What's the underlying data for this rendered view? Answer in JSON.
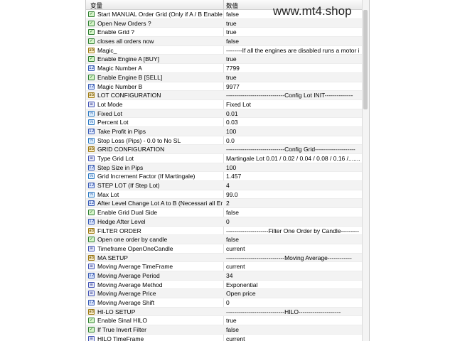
{
  "header": {
    "col_name": "变量",
    "col_value": "数值"
  },
  "watermark": "www.mt4.shop",
  "rows": [
    {
      "icon": "bool",
      "name": "Start MANUAL Order  Grid  (Only if A / B Enable)",
      "value": "false"
    },
    {
      "icon": "bool",
      "name": "Open New Orders ?",
      "value": "true"
    },
    {
      "icon": "bool",
      "name": "Enable Grid ?",
      "value": "true"
    },
    {
      "icon": "bool",
      "name": "closes all orders now",
      "value": "false"
    },
    {
      "icon": "str",
      "name": "Magic_",
      "value": "--------If all the engines are disabled runs a motor i..."
    },
    {
      "icon": "bool",
      "name": "Enable Engine A   [BUY]",
      "value": "true"
    },
    {
      "icon": "num",
      "name": "Magic Number  A",
      "value": "7799"
    },
    {
      "icon": "bool",
      "name": "Enable Engine B   [SELL]",
      "value": "true"
    },
    {
      "icon": "num",
      "name": "Magic Number  B",
      "value": "9977"
    },
    {
      "icon": "str",
      "name": "LOT CONFIGURATION",
      "value": "-----------------------------Config Lot INIT--------------"
    },
    {
      "icon": "enm",
      "name": "Lot Mode",
      "value": "Fixed Lot"
    },
    {
      "icon": "dbl",
      "name": "Fixed Lot",
      "value": "0.01"
    },
    {
      "icon": "dbl",
      "name": "Percent Lot",
      "value": "0.03"
    },
    {
      "icon": "num",
      "name": "Take Profit in Pips",
      "value": "100"
    },
    {
      "icon": "dbl",
      "name": "Stop Loss (Pips) - 0.0 to No SL",
      "value": "0.0"
    },
    {
      "icon": "str",
      "name": "GRID CONFIGURATION",
      "value": "-----------------------------Config Grid--------------------"
    },
    {
      "icon": "enm",
      "name": "Type Grid Lot",
      "value": "Martingale Lot  0.01 / 0.02 / 0.04 / 0.08 / 0.16 /........"
    },
    {
      "icon": "num",
      "name": "Step Size in Pips",
      "value": "100"
    },
    {
      "icon": "dbl",
      "name": "Grid Increment Factor (If Martingale)",
      "value": "1.457"
    },
    {
      "icon": "num",
      "name": "STEP LOT (If  Step Lot)",
      "value": "4"
    },
    {
      "icon": "dbl",
      "name": "Max Lot",
      "value": "99.0"
    },
    {
      "icon": "num",
      "name": "After Level Change Lot A to B (Necessari all Engi...",
      "value": "2"
    },
    {
      "icon": "bool",
      "name": "Enable Grid Dual Side",
      "value": "false"
    },
    {
      "icon": "num",
      "name": "Hedge After Level",
      "value": "0"
    },
    {
      "icon": "str",
      "name": "FILTER ORDER",
      "value": "---------------------Filter One Order by Candle---------"
    },
    {
      "icon": "bool",
      "name": "Open one order by candle",
      "value": "false"
    },
    {
      "icon": "enm",
      "name": "Timeframe OpenOneCandle",
      "value": "current"
    },
    {
      "icon": "str",
      "name": "MA SETUP",
      "value": "-----------------------------Moving Average------------"
    },
    {
      "icon": "enm",
      "name": "Moving Average TimeFrame",
      "value": "current"
    },
    {
      "icon": "num",
      "name": "Moving Average Period",
      "value": "34"
    },
    {
      "icon": "enm",
      "name": "Moving Average Method",
      "value": "Exponential"
    },
    {
      "icon": "enm",
      "name": "Moving Average Price",
      "value": "Open price"
    },
    {
      "icon": "num",
      "name": "Moving Average Shift",
      "value": "0"
    },
    {
      "icon": "str",
      "name": "HI-LO SETUP",
      "value": "-----------------------------HILO---------------------"
    },
    {
      "icon": "bool",
      "name": "Enable Sinal  HILO",
      "value": "true"
    },
    {
      "icon": "bool",
      "name": "If True Invert Filter",
      "value": "false"
    },
    {
      "icon": "enm",
      "name": "HILO TimeFrame",
      "value": "current"
    }
  ]
}
